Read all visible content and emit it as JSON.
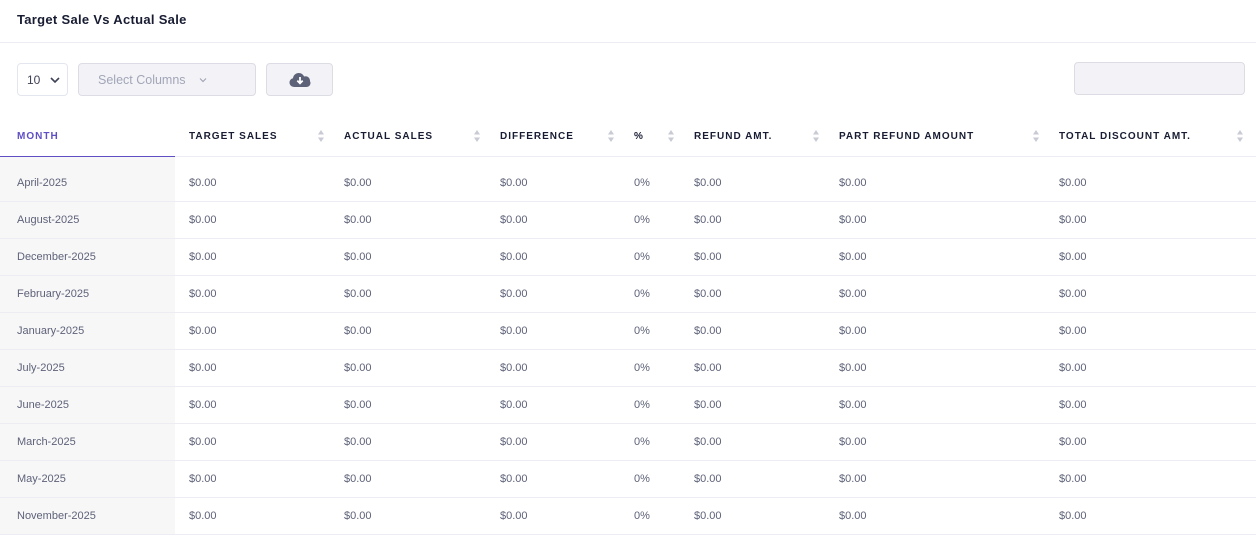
{
  "card": {
    "title": "Target Sale Vs Actual Sale"
  },
  "toolbar": {
    "page_length": "10",
    "select_columns_placeholder": "Select Columns",
    "export_icon": "cloud-download-icon",
    "search_value": ""
  },
  "colors": {
    "accent": "#5e4fc5",
    "text": "#3f4254",
    "header_text": "#181c32"
  },
  "table": {
    "columns": [
      "MONTH",
      "TARGET SALES",
      "ACTUAL SALES",
      "DIFFERENCE",
      "%",
      "REFUND AMT.",
      "PART REFUND AMOUNT",
      "TOTAL DISCOUNT AMT."
    ],
    "rows": [
      [
        "April-2025",
        "$0.00",
        "$0.00",
        "$0.00",
        "0%",
        "$0.00",
        "$0.00",
        "$0.00"
      ],
      [
        "August-2025",
        "$0.00",
        "$0.00",
        "$0.00",
        "0%",
        "$0.00",
        "$0.00",
        "$0.00"
      ],
      [
        "December-2025",
        "$0.00",
        "$0.00",
        "$0.00",
        "0%",
        "$0.00",
        "$0.00",
        "$0.00"
      ],
      [
        "February-2025",
        "$0.00",
        "$0.00",
        "$0.00",
        "0%",
        "$0.00",
        "$0.00",
        "$0.00"
      ],
      [
        "January-2025",
        "$0.00",
        "$0.00",
        "$0.00",
        "0%",
        "$0.00",
        "$0.00",
        "$0.00"
      ],
      [
        "July-2025",
        "$0.00",
        "$0.00",
        "$0.00",
        "0%",
        "$0.00",
        "$0.00",
        "$0.00"
      ],
      [
        "June-2025",
        "$0.00",
        "$0.00",
        "$0.00",
        "0%",
        "$0.00",
        "$0.00",
        "$0.00"
      ],
      [
        "March-2025",
        "$0.00",
        "$0.00",
        "$0.00",
        "0%",
        "$0.00",
        "$0.00",
        "$0.00"
      ],
      [
        "May-2025",
        "$0.00",
        "$0.00",
        "$0.00",
        "0%",
        "$0.00",
        "$0.00",
        "$0.00"
      ],
      [
        "November-2025",
        "$0.00",
        "$0.00",
        "$0.00",
        "0%",
        "$0.00",
        "$0.00",
        "$0.00"
      ]
    ]
  }
}
